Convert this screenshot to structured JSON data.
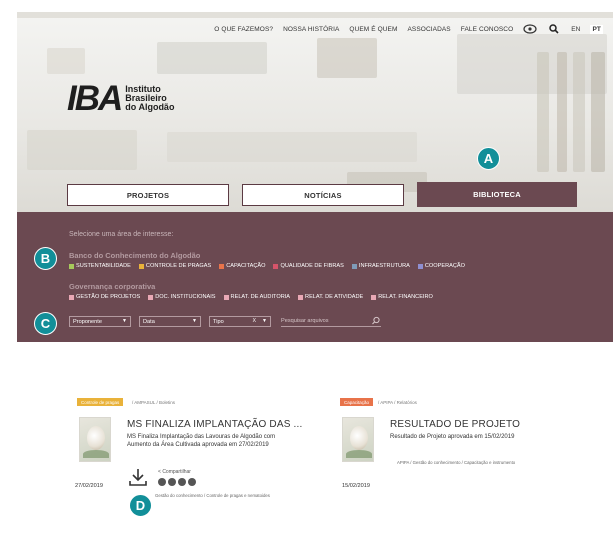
{
  "topnav": {
    "items": [
      "O QUE FAZEMOS?",
      "NOSSA HISTÓRIA",
      "QUEM É QUEM",
      "ASSOCIADAS",
      "FALE CONOSCO"
    ],
    "lang_en": "EN",
    "lang_pt": "PT",
    "icons": [
      "accessibility-icon",
      "search-icon"
    ]
  },
  "logo": {
    "mark": "IBA",
    "line1": "Instituto",
    "line2": "Brasileiro",
    "line3": "do Algodão"
  },
  "tabs": [
    {
      "label": "PROJETOS",
      "active": false
    },
    {
      "label": "NOTÍCIAS",
      "active": false
    },
    {
      "label": "BIBLIOTECA",
      "active": true
    }
  ],
  "badges": {
    "a": "A",
    "b": "B",
    "c": "C",
    "d": "D"
  },
  "panel": {
    "select_label": "Selecione uma área de interesse:",
    "group1": {
      "heading": "Banco do Conhecimento do Algodão",
      "items": [
        {
          "label": "SUSTENTABILIDADE",
          "color": "#a7c95b"
        },
        {
          "label": "CONTROLE DE PRAGAS",
          "color": "#e9b23a"
        },
        {
          "label": "CAPACITAÇÃO",
          "color": "#e8734a"
        },
        {
          "label": "QUALIDADE DE FIBRAS",
          "color": "#d6546a"
        },
        {
          "label": "INFRAESTRUTURA",
          "color": "#7f9bb8"
        },
        {
          "label": "COOPERAÇÃO",
          "color": "#8f8fd0"
        }
      ]
    },
    "group2": {
      "heading": "Governança corporativa",
      "items": [
        {
          "label": "GESTÃO DE PROJETOS",
          "color": "#e9a8b5"
        },
        {
          "label": "DOC. INSTITUCIONAIS",
          "color": "#e9a8b5"
        },
        {
          "label": "RELAT. DE AUDITORIA",
          "color": "#e9a8b5"
        },
        {
          "label": "RELAT. DE ATIVIDADE",
          "color": "#e9a8b5"
        },
        {
          "label": "RELAT. FINANCEIRO",
          "color": "#e9a8b5"
        }
      ]
    },
    "filters": {
      "proponente": "Proponente",
      "data": "Data",
      "tipo": "Tipo",
      "tipo_clear": "X",
      "search_placeholder": "Pesquisar arquivos"
    }
  },
  "cards": [
    {
      "category": "Controle de pragas",
      "category_color": "#e9b23a",
      "crumb": "/ AMPASUL / Boletins",
      "title": "MS FINALIZA IMPLANTAÇÃO DAS ...",
      "desc": "MS Finaliza Implantação das Lavouras de Algodão com Aumento da Área Cultivada aprovada em 27/02/2019",
      "date": "27/02/2019",
      "share": "Compartilhar",
      "tags": "Gestão do conhecimento / Controle de pragas e nematoides"
    },
    {
      "category": "Capacitação",
      "category_color": "#e8734a",
      "crumb": "/ APIPA / Relatórios",
      "title": "RESULTADO DE PROJETO",
      "desc": "Resultado de Projeto aprovada em 15/02/2019",
      "date": "15/02/2019",
      "tags": "APIPA / Gestão do conhecimento / Capacitação e instrumento"
    }
  ],
  "colors": {
    "panel": "#6b4951",
    "badge": "#128f99"
  }
}
